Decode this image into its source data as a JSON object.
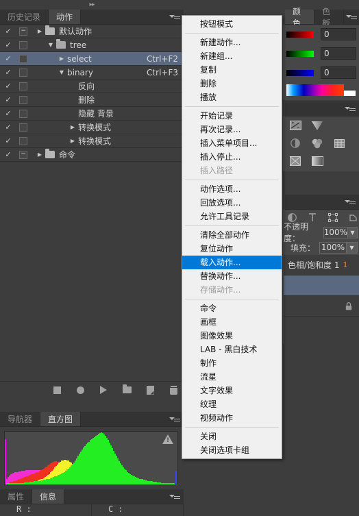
{
  "actions_panel": {
    "tabs": [
      {
        "label": "历史记录",
        "active": false
      },
      {
        "label": "动作",
        "active": true
      }
    ],
    "rows": [
      {
        "check": "✓",
        "box": "−",
        "toggle": "▶",
        "folder": "closed",
        "label": "默认动作",
        "key": "",
        "indent": 0,
        "selected": false
      },
      {
        "check": "✓",
        "box": "",
        "toggle": "▼",
        "folder": "open",
        "label": "tree",
        "key": "",
        "indent": 1,
        "selected": false
      },
      {
        "check": "✓",
        "box": "",
        "toggle": "▶",
        "folder": "none",
        "label": "select",
        "key": "Ctrl+F2",
        "indent": 2,
        "selected": true
      },
      {
        "check": "✓",
        "box": "",
        "toggle": "▼",
        "folder": "none",
        "label": "binary",
        "key": "Ctrl+F3",
        "indent": 2,
        "selected": false
      },
      {
        "check": "✓",
        "box": "",
        "toggle": "",
        "folder": "none",
        "label": "反向",
        "key": "",
        "indent": 3,
        "selected": false
      },
      {
        "check": "✓",
        "box": "",
        "toggle": "",
        "folder": "none",
        "label": "删除",
        "key": "",
        "indent": 3,
        "selected": false
      },
      {
        "check": "✓",
        "box": "",
        "toggle": "",
        "folder": "none",
        "label": "隐藏 背景",
        "key": "",
        "indent": 3,
        "selected": false
      },
      {
        "check": "✓",
        "box": "",
        "toggle": "▶",
        "folder": "none",
        "label": "转换模式",
        "key": "",
        "indent": 3,
        "selected": false
      },
      {
        "check": "✓",
        "box": "",
        "toggle": "▶",
        "folder": "none",
        "label": "转换模式",
        "key": "",
        "indent": 3,
        "selected": false
      },
      {
        "check": "✓",
        "box": "−",
        "toggle": "▶",
        "folder": "closed",
        "label": "命令",
        "key": "",
        "indent": 0,
        "selected": false
      }
    ],
    "footer_icons": [
      "stop-icon",
      "record-icon",
      "play-icon",
      "new-group-icon",
      "new-action-icon",
      "delete-icon"
    ]
  },
  "context_menu": {
    "groups": [
      [
        "按钮模式"
      ],
      [
        "新建动作...",
        "新建组...",
        "复制",
        "删除",
        "播放"
      ],
      [
        "开始记录",
        "再次记录...",
        "插入菜单项目...",
        "插入停止...",
        "插入路径"
      ],
      [
        "动作选项...",
        "回放选项...",
        "允许工具记录"
      ],
      [
        "清除全部动作",
        "复位动作",
        "载入动作...",
        "替换动作...",
        "存储动作..."
      ],
      [
        "命令",
        "画框",
        "图像效果",
        "LAB - 黑白技术",
        "制作",
        "流星",
        "文字效果",
        "纹理",
        "视频动作"
      ],
      [
        "关闭",
        "关闭选项卡组"
      ]
    ],
    "highlighted": "载入动作...",
    "disabled": [
      "插入路径",
      "存储动作..."
    ],
    "highlight_color": "#0078d7"
  },
  "color_panel": {
    "tabs": [
      {
        "label": "颜色",
        "active": true
      },
      {
        "label": "色板",
        "active": false
      }
    ],
    "sliders": [
      {
        "channel": "R",
        "value": "0"
      },
      {
        "channel": "G",
        "value": "0"
      },
      {
        "channel": "B",
        "value": "0"
      }
    ]
  },
  "adjustments_panel": {
    "icons_row1": [
      "brightness-contrast-icon",
      "levels-icon"
    ],
    "icons_row2": [
      "exposure-icon",
      "color-balance-icon",
      "channel-mixer-icon"
    ],
    "icons_row3": [
      "invert-icon",
      "gradient-map-icon"
    ]
  },
  "layers_panel": {
    "tool_icons": [
      "opacity-pie-icon",
      "type-icon",
      "path-icon",
      "shape-icon"
    ],
    "opacity_label": "不透明度：",
    "opacity_value": "100%",
    "fill_label": "填充：",
    "fill_value": "100%",
    "layers": [
      {
        "name": "色相/饱和度 1",
        "badge": "1",
        "selected": false,
        "locked": false
      },
      {
        "name": "",
        "badge": "",
        "selected": true,
        "locked": false
      },
      {
        "name": "",
        "badge": "",
        "selected": false,
        "locked": true
      }
    ]
  },
  "histogram_panel": {
    "tabs": [
      {
        "label": "导航器",
        "active": false
      },
      {
        "label": "直方图",
        "active": true
      }
    ],
    "warning_icon": "cached-data-warning-icon"
  },
  "info_panel": {
    "tabs": [
      {
        "label": "属性",
        "active": false
      },
      {
        "label": "信息",
        "active": true
      }
    ],
    "readouts": [
      {
        "label": "R :"
      },
      {
        "label": "C :"
      }
    ]
  },
  "chart_data": {
    "type": "area",
    "title": "直方图",
    "xlabel": "",
    "ylabel": "",
    "xlim": [
      0,
      255
    ],
    "ylim": [
      0,
      100
    ],
    "grid": false,
    "legend": "none",
    "series": [
      {
        "name": "green",
        "color": "#22ee22",
        "values": [
          2,
          2,
          2,
          2,
          2,
          2,
          2,
          2,
          2,
          3,
          3,
          3,
          3,
          3,
          4,
          4,
          4,
          4,
          5,
          5,
          5,
          6,
          6,
          6,
          7,
          7,
          8,
          8,
          9,
          9,
          10,
          11,
          11,
          12,
          13,
          14,
          15,
          16,
          17,
          18,
          19,
          21,
          22,
          24,
          26,
          28,
          30,
          33,
          36,
          39,
          42,
          46,
          50,
          54,
          58,
          62,
          66,
          70,
          73,
          76,
          79,
          81,
          84,
          86,
          88,
          90,
          92,
          94,
          96,
          98,
          99,
          97,
          95,
          92,
          88,
          84,
          79,
          74,
          69,
          64,
          59,
          54,
          49,
          44,
          40,
          36,
          33,
          30,
          27,
          24,
          22,
          20,
          18,
          17,
          15,
          14,
          13,
          12,
          11,
          10,
          10,
          9,
          8,
          8,
          7,
          7,
          6,
          6,
          5,
          5,
          5,
          4,
          4,
          4,
          3,
          3,
          3,
          3,
          2,
          2,
          2,
          2,
          2,
          2,
          1,
          1
        ]
      },
      {
        "name": "yellow",
        "color": "#f2f22b",
        "values": [
          1,
          1,
          1,
          1,
          1,
          1,
          1,
          2,
          2,
          2,
          2,
          2,
          3,
          3,
          3,
          3,
          4,
          4,
          4,
          5,
          5,
          6,
          6,
          7,
          8,
          9,
          10,
          11,
          12,
          14,
          16,
          18,
          20,
          23,
          26,
          29,
          32,
          35,
          38,
          41,
          43,
          45,
          46,
          47,
          47,
          46,
          45,
          43,
          41,
          39,
          36,
          34,
          31,
          29,
          27,
          25,
          23,
          21,
          19,
          17,
          16,
          14,
          13,
          12,
          11,
          10,
          9,
          8,
          7,
          7,
          6,
          6,
          5,
          5,
          4,
          4,
          4,
          3,
          3,
          3,
          3,
          2,
          2,
          2,
          2,
          2,
          2,
          1,
          1,
          1,
          1,
          1,
          1,
          1,
          1,
          1,
          1,
          1,
          1,
          1,
          1,
          1,
          1,
          1,
          1,
          1,
          1,
          1,
          1,
          1,
          1,
          1,
          1,
          1,
          1,
          1,
          1,
          1,
          1,
          1,
          1,
          1,
          1,
          1,
          1,
          1
        ]
      },
      {
        "name": "red",
        "color": "#f03020",
        "values": [
          2,
          3,
          3,
          4,
          5,
          5,
          6,
          7,
          8,
          9,
          10,
          11,
          12,
          13,
          14,
          15,
          16,
          17,
          18,
          19,
          20,
          21,
          22,
          23,
          24,
          26,
          27,
          29,
          30,
          32,
          34,
          36,
          38,
          40,
          42,
          43,
          44,
          44,
          43,
          41,
          38,
          35,
          31,
          28,
          25,
          22,
          19,
          17,
          15,
          13,
          11,
          10,
          9,
          8,
          7,
          6,
          6,
          5,
          5,
          4,
          4,
          3,
          3,
          3,
          2,
          2,
          2,
          2,
          2,
          2,
          1,
          1,
          1,
          1,
          1,
          1,
          1,
          1,
          1,
          1,
          1,
          1,
          1,
          1,
          1,
          1,
          1,
          1,
          1,
          1,
          1,
          1,
          1,
          1,
          1,
          1,
          1,
          1,
          1,
          1,
          1,
          1,
          1,
          1,
          1,
          1,
          1,
          1,
          1,
          1,
          1,
          1,
          1,
          1,
          1,
          1,
          1,
          1,
          1,
          1,
          1,
          1,
          1,
          1,
          1,
          1
        ]
      },
      {
        "name": "magenta",
        "color": "#f12fd0",
        "values": [
          6,
          10,
          14,
          17,
          19,
          21,
          22,
          23,
          24,
          24,
          25,
          25,
          26,
          26,
          26,
          27,
          27,
          27,
          27,
          27,
          27,
          27,
          27,
          27,
          27,
          27,
          27,
          27,
          27,
          27,
          27,
          26,
          26,
          26,
          25,
          24,
          22,
          19,
          15,
          11,
          7,
          4,
          2,
          1,
          1,
          1,
          1,
          1,
          1,
          1,
          1,
          1,
          1,
          1,
          1,
          1,
          1,
          1,
          1,
          1,
          1,
          1,
          1,
          1,
          1,
          1,
          1,
          1,
          1,
          1,
          1,
          1,
          1,
          1,
          1,
          1,
          1,
          1,
          1,
          1,
          1,
          1,
          1,
          1,
          1,
          1,
          1,
          1,
          1,
          1,
          1,
          1,
          1,
          1,
          1,
          1,
          1,
          1,
          1,
          1,
          1,
          1,
          1,
          1,
          1,
          1,
          1,
          1,
          1,
          1,
          1,
          1,
          1,
          1,
          1,
          1,
          1,
          1,
          1,
          1,
          1,
          1,
          1,
          1,
          1,
          1
        ]
      },
      {
        "name": "gray",
        "color": "#6b6b63",
        "values": [
          3,
          4,
          5,
          6,
          7,
          8,
          9,
          10,
          11,
          12,
          12,
          13,
          13,
          14,
          14,
          14,
          15,
          15,
          15,
          15,
          15,
          15,
          15,
          15,
          15,
          15,
          15,
          15,
          15,
          15,
          15,
          15,
          15,
          15,
          15,
          15,
          15,
          15,
          15,
          14,
          14,
          14,
          14,
          13,
          13,
          13,
          12,
          12,
          12,
          11,
          11,
          11,
          10,
          10,
          10,
          9,
          9,
          9,
          8,
          8,
          8,
          7,
          7,
          7,
          6,
          6,
          6,
          5,
          5,
          5,
          5,
          4,
          4,
          4,
          4,
          3,
          3,
          3,
          3,
          3,
          3,
          2,
          2,
          2,
          2,
          2,
          2,
          2,
          2,
          1,
          1,
          1,
          1,
          1,
          1,
          1,
          1,
          1,
          1,
          1,
          1,
          1,
          1,
          1,
          1,
          1,
          1,
          1,
          1,
          1,
          1,
          1,
          1,
          1,
          1,
          1,
          1,
          1,
          1,
          1,
          1,
          1,
          1,
          1,
          1,
          1
        ]
      }
    ],
    "markers": [
      {
        "name": "left-clip-magenta",
        "x": 0,
        "color": "#ff00ff"
      },
      {
        "name": "right-clip-blue",
        "x": 255,
        "color": "#4040ff"
      }
    ]
  }
}
